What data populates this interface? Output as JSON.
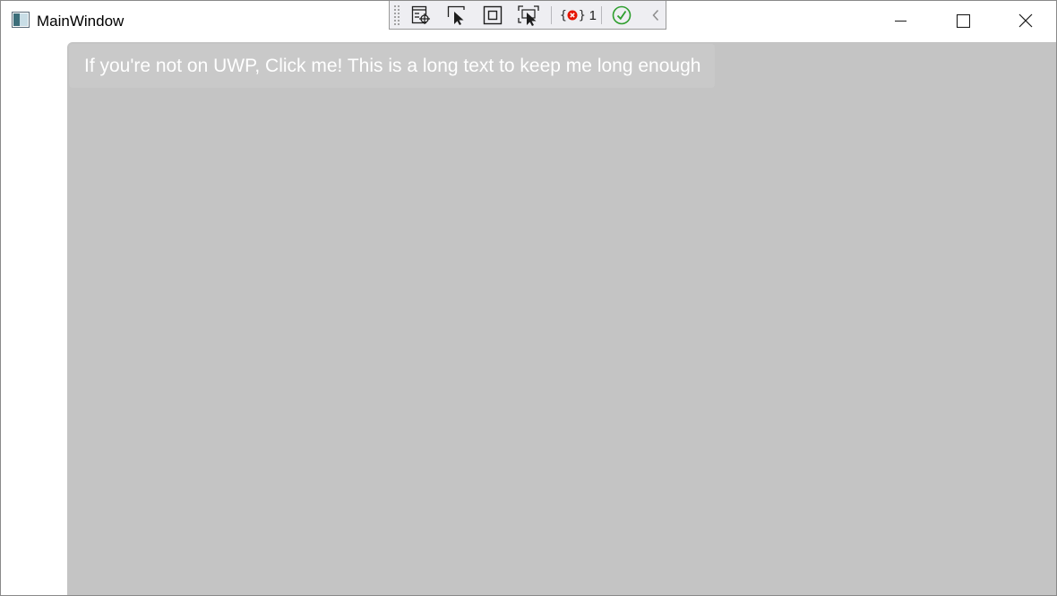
{
  "window": {
    "title": "MainWindow",
    "app_icon": "window-app-icon"
  },
  "caption_buttons": {
    "minimize_icon": "minimize-icon",
    "maximize_icon": "maximize-icon",
    "close_icon": "close-icon"
  },
  "debug_toolbar": {
    "tools": [
      {
        "name": "live-visual-tree-icon"
      },
      {
        "name": "select-element-icon"
      },
      {
        "name": "display-layout-adorners-icon"
      },
      {
        "name": "track-focus-icon"
      }
    ],
    "binding_errors_count": "1",
    "hot_reload_status_icon": "checkmark-status-icon",
    "collapse_icon": "chevron-left-icon"
  },
  "content": {
    "button_label": "If you're not on UWP, Click me! This is a long text to keep me long enough"
  },
  "colors": {
    "panel_background": "#c4c4c4",
    "button_background": "#c9c9c9",
    "button_text": "#ffffff",
    "status_ok": "#2d9e2d",
    "error_red": "#e51400"
  }
}
